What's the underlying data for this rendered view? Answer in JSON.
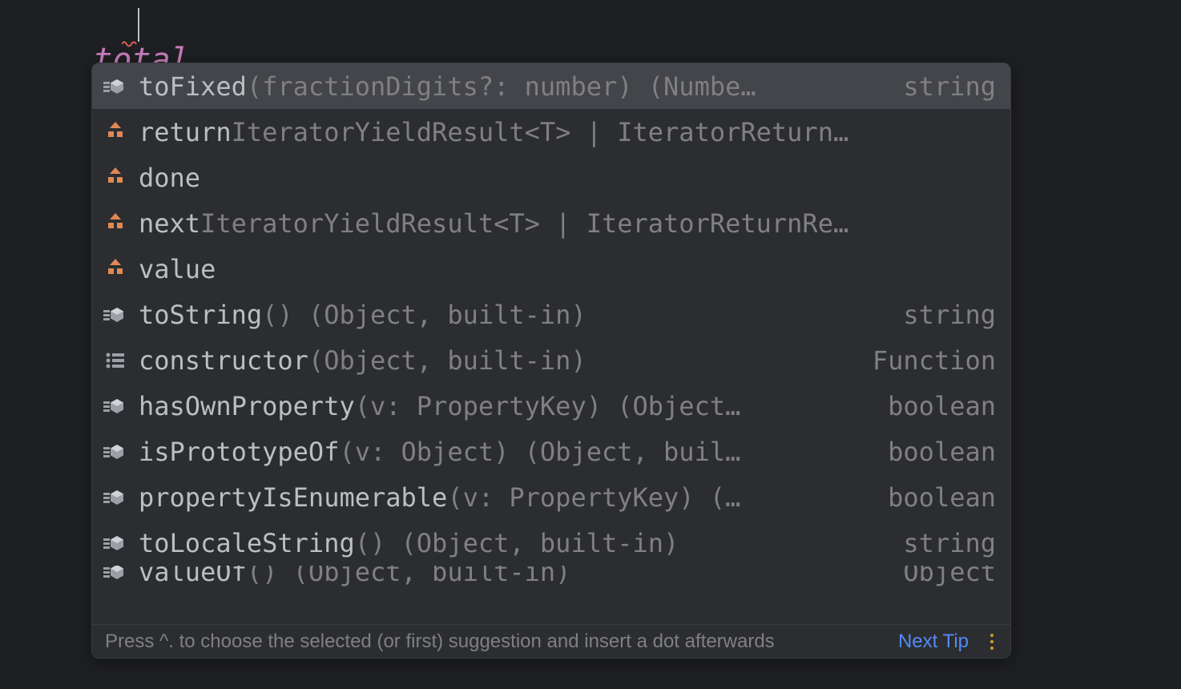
{
  "editor": {
    "variable": "total",
    "dot": "."
  },
  "suggestions": [
    {
      "icon": "method",
      "label": "toFixed",
      "sig": "(fractionDigits?: number) (Numbe…",
      "ret": "string",
      "selected": true
    },
    {
      "icon": "property",
      "label": "return  ",
      "sig": "IteratorYieldResult<T> | IteratorReturn…",
      "ret": ""
    },
    {
      "icon": "property",
      "label": "done",
      "sig": "",
      "ret": ""
    },
    {
      "icon": "property",
      "label": "next  ",
      "sig": "IteratorYieldResult<T> | IteratorReturnRe…",
      "ret": ""
    },
    {
      "icon": "property",
      "label": "value",
      "sig": "",
      "ret": ""
    },
    {
      "icon": "method",
      "label": "toString",
      "sig": "() (Object, built-in)",
      "ret": "string"
    },
    {
      "icon": "field-list",
      "label": "constructor ",
      "sig": "(Object, built-in)",
      "ret": "Function"
    },
    {
      "icon": "method",
      "label": "hasOwnProperty",
      "sig": "(v: PropertyKey) (Object…",
      "ret": "boolean"
    },
    {
      "icon": "method",
      "label": "isPrototypeOf",
      "sig": "(v: Object) (Object, buil…",
      "ret": "boolean"
    },
    {
      "icon": "method",
      "label": "propertyIsEnumerable",
      "sig": "(v: PropertyKey) (…",
      "ret": "boolean"
    },
    {
      "icon": "method",
      "label": "toLocaleString",
      "sig": "() (Object, built-in)",
      "ret": "string"
    },
    {
      "icon": "method",
      "label": "valueOf",
      "sig": "() (Object, built-in)",
      "ret": "Object",
      "partial": true
    }
  ],
  "footer": {
    "tip": "Press ^. to choose the selected (or first) suggestion and insert a dot afterwards",
    "next": "Next Tip"
  }
}
